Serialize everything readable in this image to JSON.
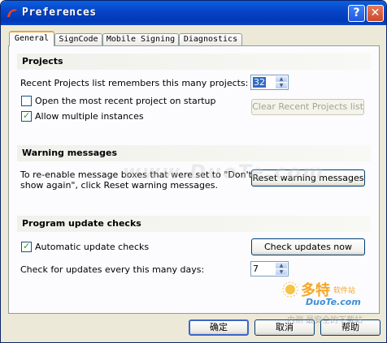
{
  "window": {
    "title": "Preferences",
    "help_button": "?",
    "close_button": "✕"
  },
  "tabs": [
    {
      "label": "General"
    },
    {
      "label": "SignCode"
    },
    {
      "label": "Mobile Signing"
    },
    {
      "label": "Diagnostics"
    }
  ],
  "projects": {
    "title": "Projects",
    "recent_label": "Recent Projects list remembers this many projects:",
    "recent_value": "32",
    "open_recent_label": "Open the most recent project on startup",
    "open_recent_checked": false,
    "allow_multiple_label": "Allow multiple instances",
    "allow_multiple_checked": true,
    "clear_button": "Clear Recent Projects list"
  },
  "warnings": {
    "title": "Warning messages",
    "text_line1": "To re-enable message boxes that were set to \"Don't",
    "text_line2": "show again\", click Reset warning messages.",
    "reset_button": "Reset warning messages"
  },
  "updates": {
    "title": "Program update checks",
    "auto_label": "Automatic update checks",
    "auto_checked": true,
    "check_now_button": "Check updates now",
    "days_label": "Check for updates every this many days:",
    "days_value": "7"
  },
  "footer": {
    "ok": "确定",
    "cancel": "取消",
    "help": "帮助"
  },
  "watermark": {
    "url_text": "www.DuoTe.com",
    "logo_cn": "多特",
    "logo_cn_small": "软件站",
    "logo_en": "DuoTe.com",
    "logo_sub": "内测 最安全的下载站"
  }
}
